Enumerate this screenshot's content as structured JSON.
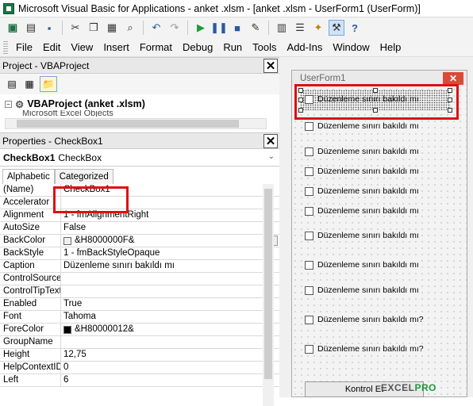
{
  "window": {
    "title": "Microsoft Visual Basic for Applications - anket .xlsm - [anket .xlsm - UserForm1 (UserForm)]"
  },
  "toolbar": {
    "icons": [
      "excel-icon",
      "insert-module-icon",
      "save-icon",
      "cut-icon",
      "copy-icon",
      "paste-icon",
      "find-icon",
      "undo-icon",
      "redo-icon",
      "run-icon",
      "break-icon",
      "reset-icon",
      "design-mode-icon",
      "project-explorer-icon",
      "properties-icon",
      "object-browser-icon",
      "toolbox-icon",
      "help-icon"
    ]
  },
  "menu": {
    "items": [
      "File",
      "Edit",
      "View",
      "Insert",
      "Format",
      "Debug",
      "Run",
      "Tools",
      "Add-Ins",
      "Window",
      "Help"
    ]
  },
  "project": {
    "header": "Project - VBAProject",
    "tree": [
      "VBAProject (anket .xlsm)",
      "Microsoft Excel Objects"
    ]
  },
  "properties": {
    "header": "Properties - CheckBox1",
    "object_name": "CheckBox1",
    "object_type": "CheckBox",
    "tabs": [
      "Alphabetic",
      "Categorized"
    ],
    "rows": [
      {
        "name": "(Name)",
        "value": "CheckBox1"
      },
      {
        "name": "Accelerator",
        "value": ""
      },
      {
        "name": "Alignment",
        "value": "1 - fmAlignmentRight"
      },
      {
        "name": "AutoSize",
        "value": "False"
      },
      {
        "name": "BackColor",
        "value": "&H8000000F&"
      },
      {
        "name": "BackStyle",
        "value": "1 - fmBackStyleOpaque"
      },
      {
        "name": "Caption",
        "value": "Düzenleme sınırı bakıldı mı"
      },
      {
        "name": "ControlSource",
        "value": ""
      },
      {
        "name": "ControlTipText",
        "value": ""
      },
      {
        "name": "Enabled",
        "value": "True"
      },
      {
        "name": "Font",
        "value": "Tahoma"
      },
      {
        "name": "ForeColor",
        "value": "&H80000012&"
      },
      {
        "name": "GroupName",
        "value": ""
      },
      {
        "name": "Height",
        "value": "12,75"
      },
      {
        "name": "HelpContextID",
        "value": "0"
      },
      {
        "name": "Left",
        "value": "6"
      }
    ],
    "colors": {
      "backcolor_swatch": "#f0f0f0",
      "forecolor_swatch": "#000000"
    }
  },
  "userform": {
    "title": "UserForm1",
    "checkboxes": [
      "Düzenleme sınırı bakıldı mı",
      "Düzenleme sınırı bakıldı mı",
      "Düzenleme sınırı bakıldı mı",
      "Düzenleme sınırı bakıldı mı",
      "Düzenleme sınırı bakıldı mı",
      "Düzenleme sınırı bakıldı mı",
      "Düzenleme sınırı bakıldı mı",
      "Düzenleme sınırı bakıldı mı",
      "Düzenleme sınırı bakıldı mı",
      "Düzenleme sınırı bakıldı mı?",
      "Düzenleme sınırı bakıldı mı?"
    ],
    "button_label": "Kontrol Et"
  },
  "watermark": {
    "prefix": "EXCEL",
    "suffix": "PRO"
  },
  "highlight_color": "#dd1111"
}
